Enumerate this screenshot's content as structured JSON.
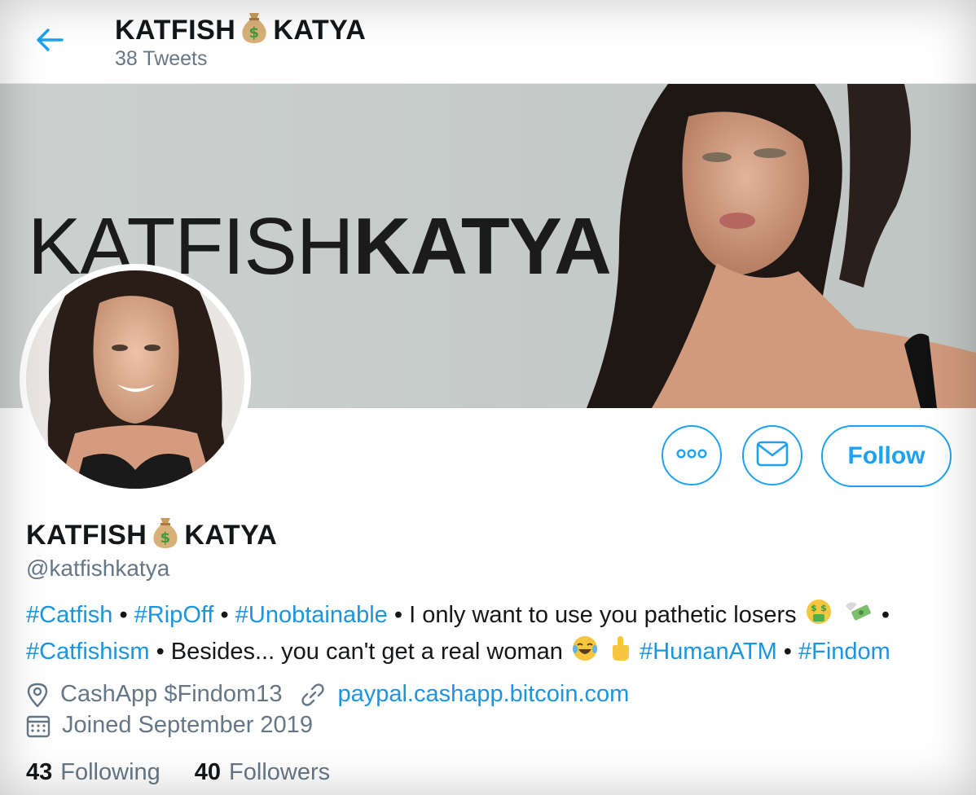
{
  "header": {
    "name_left": "KATFISH",
    "name_right": "KATYA",
    "tweet_count": "38 Tweets"
  },
  "banner": {
    "text_thin": "KATFISH",
    "text_bold": "KATYA"
  },
  "profile": {
    "name_left": "KATFISH",
    "name_right": "KATYA",
    "handle": "@katfishkatya",
    "bio": {
      "tag1": "#Catfish",
      "tag2": "#RipOff",
      "tag3": "#Unobtainable",
      "text1": "I only want to use you pathetic losers",
      "tag4": "#Catfishism",
      "text2": "Besides... you can't get a real woman",
      "tag5": "#HumanATM",
      "tag6": "#Findom",
      "sep": "•"
    },
    "location": "CashApp $Findom13",
    "website": "paypal.cashapp.bitcoin.com",
    "joined": "Joined September 2019",
    "following_count": "43",
    "following_label": "Following",
    "followers_count": "40",
    "followers_label": "Followers"
  },
  "actions": {
    "follow_label": "Follow"
  },
  "colors": {
    "accent": "#1da1f2",
    "link": "#1b95e0",
    "muted": "#657786",
    "text": "#14171a"
  },
  "icons": [
    "back-arrow-icon",
    "more-icon",
    "mail-icon",
    "location-icon",
    "link-icon",
    "calendar-icon",
    "money-bag-icon",
    "money-mouth-face-icon",
    "money-with-wings-icon",
    "crying-laughing-icon",
    "middle-finger-icon"
  ]
}
